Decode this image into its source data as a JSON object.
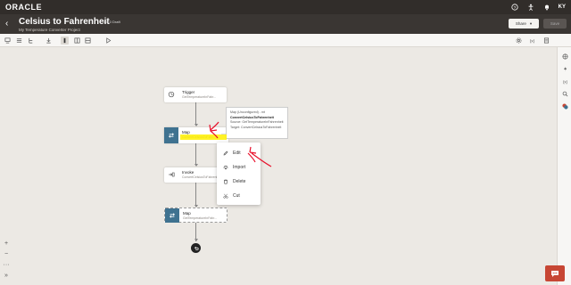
{
  "brand": {
    "logo_text": "ORACLE"
  },
  "header": {
    "title": "Celsius to Fahrenheit",
    "version": "1.0.0 Draft",
    "subtitle": "My Temperature Converter Project",
    "share_label": "Share",
    "save_label": "Save"
  },
  "user": {
    "initials": "KY"
  },
  "flow": {
    "trigger": {
      "title": "Trigger",
      "subtitle": "GetTemperatureInFahr..."
    },
    "map1": {
      "title": "Map",
      "subtitle": "ConvertCelsiusToFahr..."
    },
    "invoke": {
      "title": "Invoke",
      "subtitle": "ConvertCelsiusToFahrenheit"
    },
    "map2": {
      "title": "Map",
      "subtitle": "GetTemperatureInFahr..."
    }
  },
  "tooltip": {
    "line1": "Map (Unconfigured) - mt",
    "line2": "ConvertCelsiusToFahrenheit",
    "line3": "Source: GetTemperatureInFahrenheit",
    "line4": "Target: ConvertCelsiusToFahrenheit"
  },
  "context_menu": {
    "items": [
      {
        "label": "Edit",
        "icon": "pencil-icon"
      },
      {
        "label": "Import",
        "icon": "import-icon"
      },
      {
        "label": "Delete",
        "icon": "trash-icon"
      },
      {
        "label": "Cut",
        "icon": "scissors-icon"
      }
    ]
  },
  "zoom": {
    "zoom_in": "+",
    "zoom_out": "−",
    "more": "···",
    "expand": "»"
  },
  "colors": {
    "topbar": "#312d2a",
    "header": "#3a3633",
    "map_accent": "#3f7290",
    "chat": "#c74634",
    "highlight": "#fff000",
    "annotation": "#e8102a"
  }
}
